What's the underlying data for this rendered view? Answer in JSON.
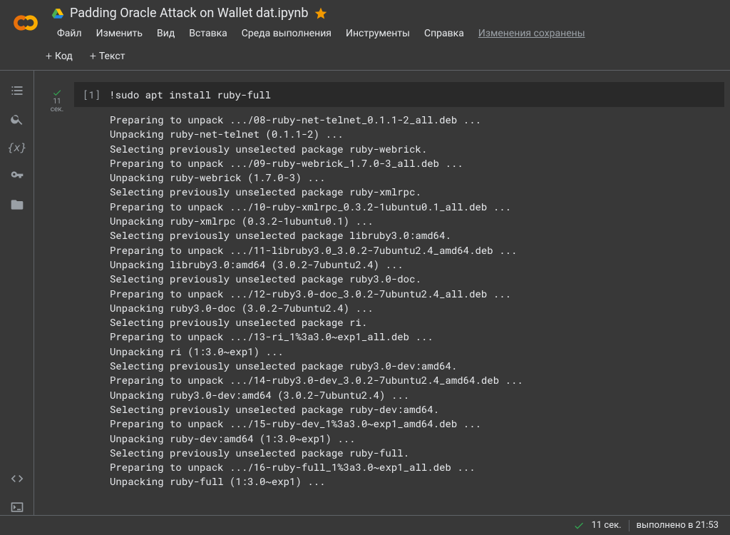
{
  "header": {
    "title": "Padding Oracle Attack on Wallet dat.ipynb",
    "menu": {
      "file": "Файл",
      "edit": "Изменить",
      "view": "Вид",
      "insert": "Вставка",
      "runtime": "Среда выполнения",
      "tools": "Инструменты",
      "help": "Справка"
    },
    "save_status": "Изменения сохранены"
  },
  "toolbar": {
    "code_label": "Код",
    "text_label": "Текст"
  },
  "cell": {
    "gutter_time": "11",
    "gutter_unit": "сек.",
    "prompt": "[1]",
    "code": "!sudo apt install ruby-full",
    "output_lines": [
      "Preparing to unpack .../08-ruby-net-telnet_0.1.1-2_all.deb ...",
      "Unpacking ruby-net-telnet (0.1.1-2) ...",
      "Selecting previously unselected package ruby-webrick.",
      "Preparing to unpack .../09-ruby-webrick_1.7.0-3_all.deb ...",
      "Unpacking ruby-webrick (1.7.0-3) ...",
      "Selecting previously unselected package ruby-xmlrpc.",
      "Preparing to unpack .../10-ruby-xmlrpc_0.3.2-1ubuntu0.1_all.deb ...",
      "Unpacking ruby-xmlrpc (0.3.2-1ubuntu0.1) ...",
      "Selecting previously unselected package libruby3.0:amd64.",
      "Preparing to unpack .../11-libruby3.0_3.0.2-7ubuntu2.4_amd64.deb ...",
      "Unpacking libruby3.0:amd64 (3.0.2-7ubuntu2.4) ...",
      "Selecting previously unselected package ruby3.0-doc.",
      "Preparing to unpack .../12-ruby3.0-doc_3.0.2-7ubuntu2.4_all.deb ...",
      "Unpacking ruby3.0-doc (3.0.2-7ubuntu2.4) ...",
      "Selecting previously unselected package ri.",
      "Preparing to unpack .../13-ri_1%3a3.0~exp1_all.deb ...",
      "Unpacking ri (1:3.0~exp1) ...",
      "Selecting previously unselected package ruby3.0-dev:amd64.",
      "Preparing to unpack .../14-ruby3.0-dev_3.0.2-7ubuntu2.4_amd64.deb ...",
      "Unpacking ruby3.0-dev:amd64 (3.0.2-7ubuntu2.4) ...",
      "Selecting previously unselected package ruby-dev:amd64.",
      "Preparing to unpack .../15-ruby-dev_1%3a3.0~exp1_amd64.deb ...",
      "Unpacking ruby-dev:amd64 (1:3.0~exp1) ...",
      "Selecting previously unselected package ruby-full.",
      "Preparing to unpack .../16-ruby-full_1%3a3.0~exp1_all.deb ...",
      "Unpacking ruby-full (1:3.0~exp1) ..."
    ]
  },
  "status": {
    "time": "11 сек.",
    "completed": "выполнено в 21:53"
  }
}
